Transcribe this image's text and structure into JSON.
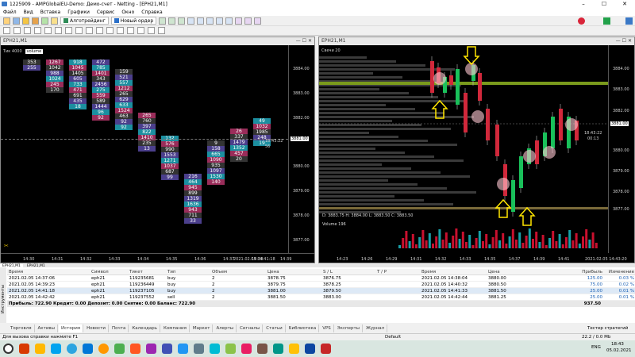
{
  "window": {
    "title": "1225909 - AMPGlobalEU-Demo: Демо-счет - Netting - [EPH21,M1]"
  },
  "menu": [
    "Файл",
    "Вид",
    "Вставка",
    "Графики",
    "Сервис",
    "Окно",
    "Справка"
  ],
  "toolbar": {
    "algo_label": "Алготрейдинг",
    "order_label": "Новый ордер"
  },
  "left_chart": {
    "tab": "EPH21,M1",
    "header_label": "Тик 4000",
    "volume_mode": "volume",
    "price_ticks": [
      "3884.00",
      "3883.00",
      "3882.00",
      "3881.00",
      "3880.00",
      "3879.00",
      "3878.00",
      "3877.00"
    ],
    "current_price": "3881.00",
    "timer": "18:43:22",
    "timer_sub": "56",
    "time_ticks": [
      "14:30",
      "14:31",
      "14:32",
      "14:33",
      "14:34",
      "14:35",
      "14:36",
      "14:37",
      "14:38",
      "14:39"
    ],
    "date_time": "2021.02.05 14:41:18",
    "columns": [
      {
        "vals": [
          "353",
          "255"
        ]
      },
      {
        "vals": [
          "1267",
          "1042",
          "988",
          "1024",
          "245",
          "170"
        ]
      },
      {
        "vals": [
          "918",
          "1045",
          "1405",
          "605",
          "733",
          "471",
          "691",
          "435",
          "18"
        ]
      },
      {
        "vals": [
          "472",
          "785",
          "1401",
          "343",
          "2456",
          "275",
          "559",
          "589",
          "1444",
          "96",
          "92"
        ]
      },
      {
        "vals": [
          "159",
          "521",
          "557",
          "1212",
          "265",
          "629",
          "633",
          "1524",
          "463",
          "92",
          "92"
        ]
      },
      {
        "vals": [
          "265",
          "760",
          "397",
          "822",
          "1410",
          "235",
          "13"
        ]
      },
      {
        "vals": [
          "132",
          "576",
          "990",
          "1553",
          "1271",
          "1037",
          "687",
          "99"
        ]
      },
      {
        "vals": [
          "216",
          "464",
          "945",
          "899",
          "1319",
          "1636",
          "943",
          "711",
          "33"
        ]
      },
      {
        "vals": [
          "9",
          "158",
          "665",
          "1090",
          "935",
          "1097",
          "1530",
          "140"
        ]
      },
      {
        "vals": [
          "26",
          "337",
          "1479",
          "1352",
          "457",
          "20"
        ]
      },
      {
        "vals": [
          "49",
          "1032",
          "1985",
          "248",
          "19"
        ]
      }
    ]
  },
  "right_chart": {
    "tab": "EPH21,M1",
    "header_label": "Свечи 20",
    "price_ticks": [
      "3884.00",
      "3883.00",
      "3882.00",
      "3881.00",
      "3880.00",
      "3879.00",
      "3878.00",
      "3877.00"
    ],
    "current_price": "3881.00",
    "timer": "18:43:22",
    "timer_sub": "00:13",
    "ohlc": "D: 3883.75  H: 3884.00  L: 3883.50  C: 3883.50",
    "volume_label": "Volume 196",
    "time_ticks": [
      "14:23",
      "14:26",
      "14:29",
      "14:31",
      "14:32",
      "14:33",
      "14:35",
      "14:37",
      "14:39",
      "14:41"
    ],
    "date_time": "2021.02.05 14:43:20"
  },
  "chart_tabs": [
    "EPH21,M1",
    "EPH21,M1"
  ],
  "table": {
    "headers": [
      "Время",
      "Символ",
      "Тикет",
      "Тип",
      "Объем",
      "Цена",
      "S / L",
      "T / P",
      "Время",
      "Цена",
      "Прибыль",
      "Изменение"
    ],
    "rows": [
      [
        "2021.02.05 14:37:06",
        "eph21",
        "119235681",
        "buy",
        "2",
        "3878.75",
        "3876.75",
        "",
        "2021.02.05 14:38:04",
        "3880.00",
        "125.00",
        "0.03 %"
      ],
      [
        "2021.02.05 14:39:23",
        "eph21",
        "119236449",
        "buy",
        "2",
        "3879.75",
        "3878.25",
        "",
        "2021.02.05 14:40:32",
        "3880.50",
        "75.00",
        "0.02 %"
      ],
      [
        "2021.02.05 14:41:18",
        "eph21",
        "119237105",
        "buy",
        "2",
        "3881.00",
        "3879.50",
        "",
        "2021.02.05 14:41:33",
        "3881.50",
        "25.00",
        "0.01 %"
      ],
      [
        "2021.02.05 14:42:42",
        "eph21",
        "119237552",
        "sell",
        "2",
        "3881.50",
        "3883.00",
        "",
        "2021.02.05 14:42:44",
        "3881.25",
        "25.00",
        "0.01 %"
      ]
    ],
    "summary": "Прибыль: 722.90  Кредит: 0.00  Депозит: 0.00  Снятие: 0.00  Баланс: 722.90",
    "summary_total": "937.50"
  },
  "bottom_tabs": [
    "Торговля",
    "Активы",
    "История",
    "Новости",
    "Почта",
    "Календарь",
    "Компания",
    "Маркет",
    "Алерты",
    "Сигналы",
    "Статьи",
    "Библиотека",
    "VPS",
    "Эксперты",
    "Журнал"
  ],
  "active_bottom_tab": "История",
  "side_label": "Инструменты",
  "status": {
    "help": "Для вызова справки нажмите F1",
    "profile": "Default",
    "tester": "Тестер стратегий",
    "net": "22.2 / 0.0 Mb"
  },
  "taskbar": {
    "time": "18:43",
    "date": "05.02.2021",
    "lang": "ENG"
  },
  "colors": {
    "teal": "#1c8fa0",
    "purple": "#4b3f8c",
    "pink": "#9a2d5a",
    "grey": "#333333",
    "up": "#19c05a",
    "down": "#d1283b",
    "vol_red": "#c8102e",
    "vol_teal": "#18a0a8",
    "poc": "#7a9a1c"
  }
}
